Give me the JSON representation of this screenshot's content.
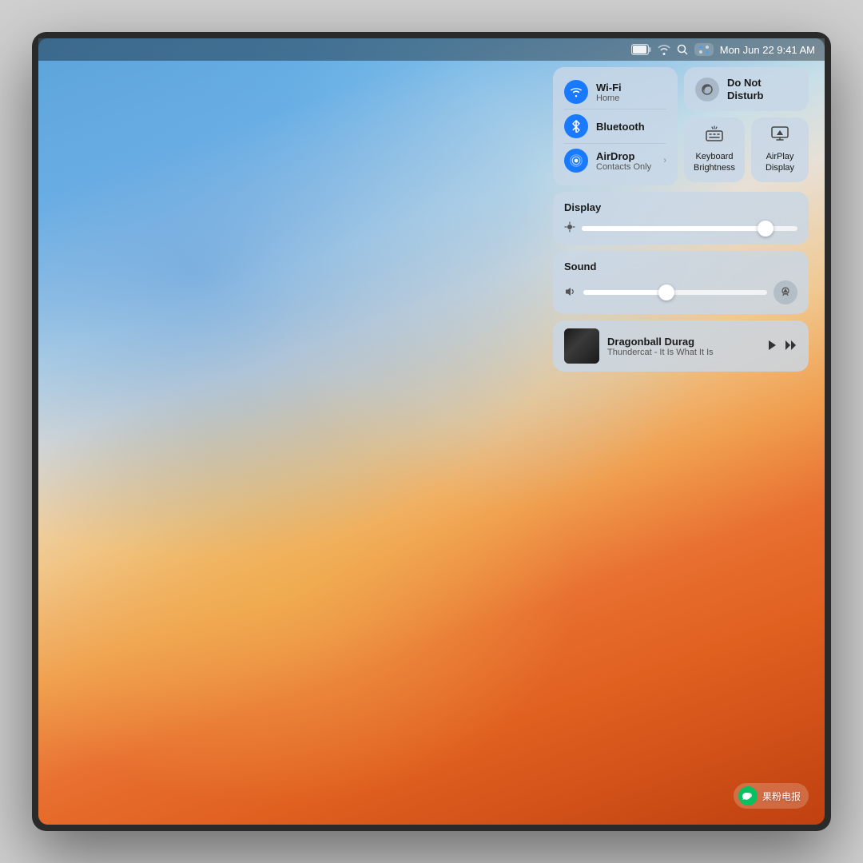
{
  "menubar": {
    "time": "Mon Jun 22  9:41 AM"
  },
  "control_center": {
    "network": {
      "wifi": {
        "title": "Wi-Fi",
        "subtitle": "Home"
      },
      "bluetooth": {
        "title": "Bluetooth"
      },
      "airdrop": {
        "title": "AirDrop",
        "subtitle": "Contacts Only"
      }
    },
    "do_not_disturb": {
      "title": "Do Not",
      "title2": "Disturb"
    },
    "keyboard_brightness": {
      "label": "Keyboard\nBrightness"
    },
    "airplay_display": {
      "label": "AirPlay\nDisplay"
    },
    "display": {
      "label": "Display",
      "brightness_pct": 85
    },
    "sound": {
      "label": "Sound",
      "volume_pct": 45
    },
    "now_playing": {
      "title": "Dragonball Durag",
      "artist": "Thundercat - It Is What It Is"
    }
  },
  "watermark": {
    "text": "果粉电报"
  }
}
